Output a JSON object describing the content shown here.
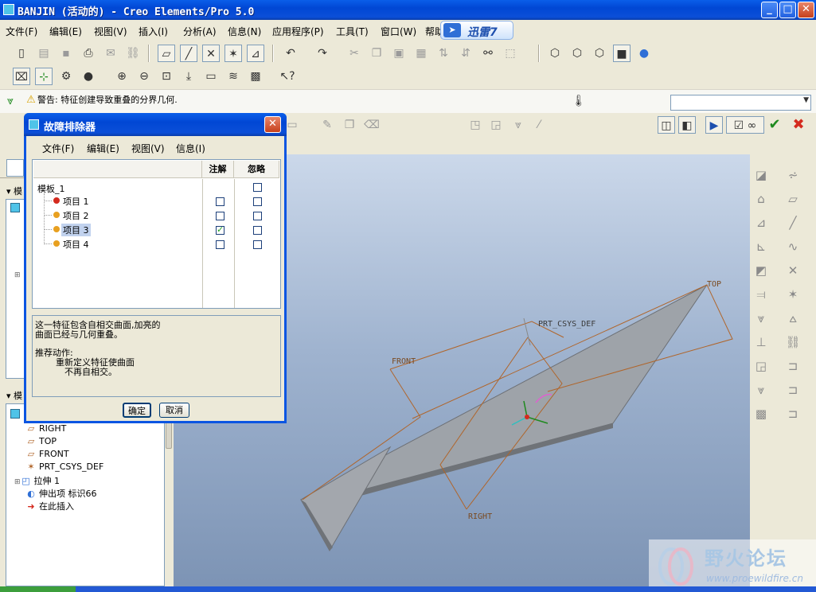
{
  "window": {
    "title": "BANJIN (活动的) - Creo Elements/Pro 5.0",
    "minimize": "_",
    "maximize": "□",
    "close": "✕"
  },
  "menubar": [
    "文件(F)",
    "编辑(E)",
    "视图(V)",
    "插入(I)",
    "分析(A)",
    "信息(N)",
    "应用程序(P)",
    "工具(T)",
    "窗口(W)",
    "帮助"
  ],
  "xunlei": {
    "label": "迅雷7",
    "icon": "bird-icon"
  },
  "message": {
    "icon": "warning-icon",
    "text": "警告: 特征创建导致重叠的分界几何."
  },
  "dialog": {
    "title": "故障排除器",
    "menu": [
      "文件(F)",
      "编辑(E)",
      "视图(V)",
      "信息(I)"
    ],
    "columns": {
      "annotate": "注解",
      "ignore": "忽略"
    },
    "root": "模板_1",
    "items": [
      {
        "label": "项目 1",
        "dot_color": "#d42a1e",
        "annotate": false,
        "ignore": false
      },
      {
        "label": "项目 2",
        "dot_color": "#e8a020",
        "annotate": false,
        "ignore": false
      },
      {
        "label": "项目 3",
        "dot_color": "#e8a020",
        "annotate": true,
        "ignore": false
      },
      {
        "label": "项目 4",
        "dot_color": "#e8a020",
        "annotate": false,
        "ignore": false
      }
    ],
    "description": {
      "line1": "这一特征包含自相交曲面,加亮的",
      "line2": "曲面已经与几何重叠。",
      "action_title": "推荐动作:",
      "action1": "重新定义特征使曲面",
      "action2": "不再自相交。"
    },
    "ok": "确定",
    "cancel": "取消"
  },
  "tree_top": {
    "label_partial": "模"
  },
  "tree": {
    "header": "模",
    "items": [
      {
        "label": "RIGHT",
        "icon": "datum-plane-icon"
      },
      {
        "label": "TOP",
        "icon": "datum-plane-icon"
      },
      {
        "label": "FRONT",
        "icon": "datum-plane-icon"
      },
      {
        "label": "PRT_CSYS_DEF",
        "icon": "csys-icon"
      },
      {
        "label": "拉伸 1",
        "icon": "extrude-icon"
      },
      {
        "label": "伸出项 标识66",
        "icon": "protrusion-icon"
      },
      {
        "label": "在此插入",
        "icon": "insert-here-icon"
      }
    ]
  },
  "graphics": {
    "labels": {
      "top": "TOP",
      "front": "FRONT",
      "right": "RIGHT",
      "csys": "PRT_CSYS_DEF"
    }
  },
  "watermark": {
    "title": "野火论坛",
    "url": "www.proewildfire.cn"
  },
  "colors": {
    "accent": "#0b55e2",
    "datum": "#b0652a"
  }
}
